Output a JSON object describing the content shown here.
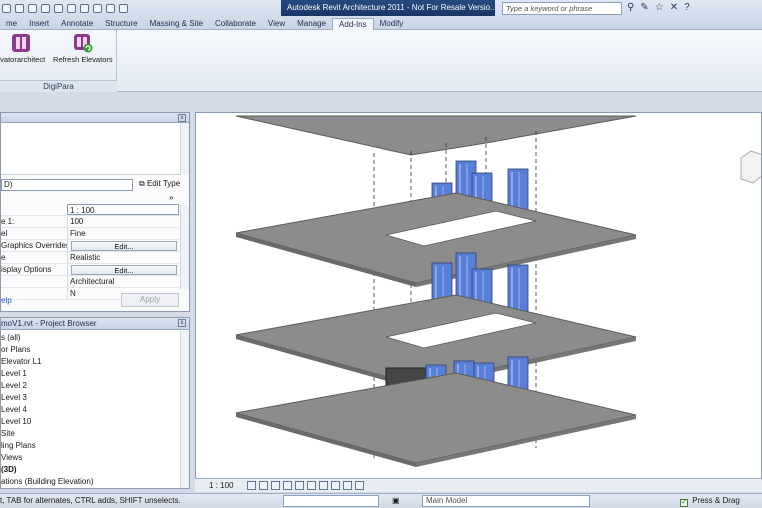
{
  "window": {
    "title": "Autodesk Revit Architecture 2011 -  Not For Resale Versio...",
    "search_placeholder": "Type a keyword or phrase"
  },
  "tabs": [
    "me",
    "Insert",
    "Annotate",
    "Structure",
    "Massing & Site",
    "Collaborate",
    "View",
    "Manage",
    "Add-Ins",
    "Modify"
  ],
  "active_tab": "Add-Ins",
  "ribbon": {
    "buttons": [
      {
        "label": "evatorarchitect",
        "icon": "elevator-architect-icon"
      },
      {
        "label": "Refresh Elevators",
        "icon": "refresh-elevators-icon"
      }
    ],
    "panel_label": "DigiPara"
  },
  "properties": {
    "type_selector": "D)",
    "edit_type": "Edit Type",
    "rows": [
      {
        "key": "",
        "value": "1 : 100",
        "kind": "input"
      },
      {
        "key": "e   1:",
        "value": "100",
        "kind": "text"
      },
      {
        "key": "el",
        "value": "Fine",
        "kind": "text"
      },
      {
        "key": "Graphics Overrides",
        "value": "Edit...",
        "kind": "button"
      },
      {
        "key": "e",
        "value": "Realistic",
        "kind": "text"
      },
      {
        "key": "isplay Options",
        "value": "Edit...",
        "kind": "button"
      },
      {
        "key": "",
        "value": "Architectural",
        "kind": "text"
      },
      {
        "key": "",
        "value": "N",
        "kind": "text"
      }
    ],
    "help": "elp",
    "apply": "Apply"
  },
  "project_browser": {
    "title": "moV1.rvt - Project Browser",
    "items": [
      "s (all)",
      "or Plans",
      "Elevator L1",
      "Level 1",
      "Level 2",
      "Level 3",
      "Level 4",
      "Level 10",
      "Site",
      "ling Plans",
      "Views",
      "(3D)",
      "ations (Building Elevation)"
    ]
  },
  "viewbar": {
    "scale": "1 : 100"
  },
  "status": {
    "text": "t, TAB for alternates, CTRL adds, SHIFT unselects.",
    "model": "Main Model",
    "press_drag": "Press & Drag"
  },
  "colors": {
    "slab": "#8c8c8c",
    "slab_edge": "#5a5a5a",
    "elevator_glass": "#5a7fd8",
    "elevator_dark": "#454545",
    "title_bar": "#1f3d74"
  }
}
